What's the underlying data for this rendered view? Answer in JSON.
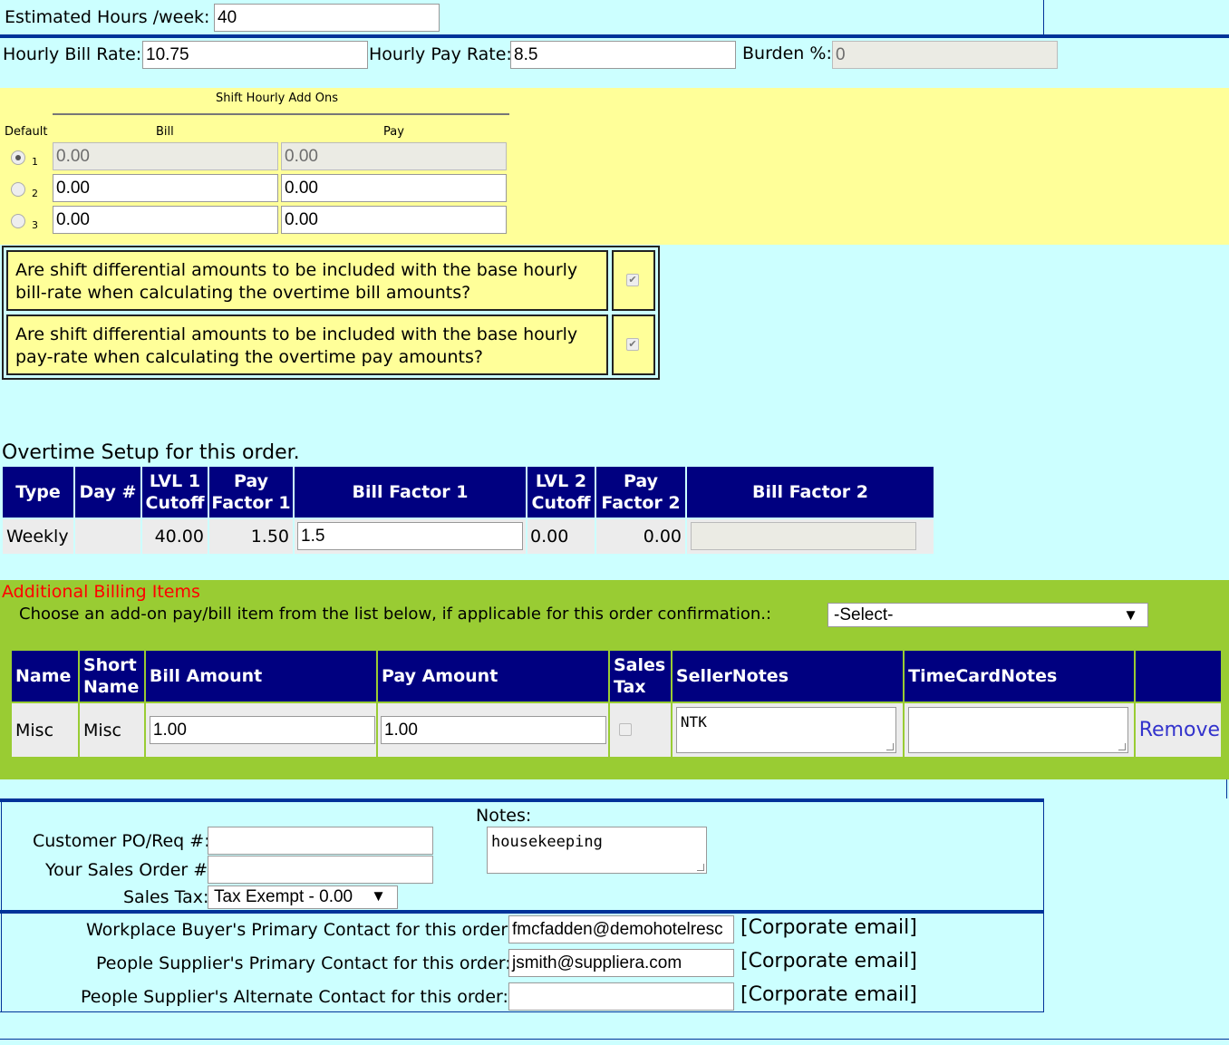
{
  "estimated_hours": {
    "label": "Estimated Hours /week:",
    "value": "40"
  },
  "rates": {
    "bill_label": "Hourly Bill Rate:",
    "bill_value": "10.75",
    "pay_label": "Hourly Pay Rate:",
    "pay_value": "8.5",
    "burden_label": "Burden %:",
    "burden_value": "0"
  },
  "shift": {
    "title": "Shift Hourly Add Ons",
    "col_default": "Default",
    "col_bill": "Bill",
    "col_pay": "Pay",
    "rows": [
      {
        "num": "1",
        "bill": "0.00",
        "pay": "0.00",
        "selected": true
      },
      {
        "num": "2",
        "bill": "0.00",
        "pay": "0.00",
        "selected": false
      },
      {
        "num": "3",
        "bill": "0.00",
        "pay": "0.00",
        "selected": false
      }
    ]
  },
  "questions": [
    {
      "line1": "Are shift differential amounts to be included with the base hourly",
      "line2": "bill-rate when calculating the overtime bill amounts?",
      "checked": true
    },
    {
      "line1": "Are shift differential amounts to be included with the base hourly",
      "line2": "pay-rate when calculating the overtime pay amounts?",
      "checked": true
    }
  ],
  "overtime": {
    "title": "Overtime Setup for this order.",
    "headers": [
      "Type",
      "Day #",
      "LVL 1 Cutoff",
      "Pay Factor 1",
      "Bill Factor 1",
      "LVL 2 Cutoff",
      "Pay Factor 2",
      "Bill Factor 2"
    ],
    "row": {
      "type": "Weekly",
      "day": "",
      "lvl1": "40.00",
      "pay1": "1.50",
      "bill1": "1.5",
      "lvl2": "0.00",
      "pay2": "0.00",
      "bill2": ""
    }
  },
  "billing": {
    "title": "Additional Billing Items",
    "choose_label": "Choose an add-on pay/bill item from the list below, if applicable for this order confirmation.:",
    "select_value": "-Select-",
    "headers": [
      "Name",
      "Short Name",
      "Bill Amount",
      "Pay Amount",
      "Sales Tax",
      "SellerNotes",
      "TimeCardNotes",
      ""
    ],
    "row": {
      "name": "Misc",
      "short": "Misc",
      "bill": "1.00",
      "pay": "1.00",
      "seller_notes": "NTK",
      "timecard_notes": "",
      "remove": "Remove"
    }
  },
  "order": {
    "po_label": "Customer PO/Req #:",
    "po_value": "",
    "so_label": "Your Sales Order #:",
    "so_value": "",
    "tax_label": "Sales Tax:",
    "tax_value": "Tax Exempt - 0.00",
    "notes_label": "Notes:",
    "notes_value": "housekeeping"
  },
  "contacts": [
    {
      "label": "Workplace Buyer's Primary Contact for this order:",
      "value": "fmcfadden@demohotelresc",
      "link": "[Corporate email]"
    },
    {
      "label": "People Supplier's Primary Contact for this order:",
      "value": "jsmith@suppliera.com",
      "link": "[Corporate email]"
    },
    {
      "label": "People Supplier's Alternate Contact for this order:",
      "value": "",
      "link": "[Corporate email]"
    }
  ],
  "colors": {
    "page_bg": "#ccffff",
    "shift_bg": "#ffff99",
    "billing_bg": "#99cc33",
    "header_bg": "#000080",
    "divider": "#003399",
    "title_red": "#ff0000",
    "link": "#3333cc"
  }
}
